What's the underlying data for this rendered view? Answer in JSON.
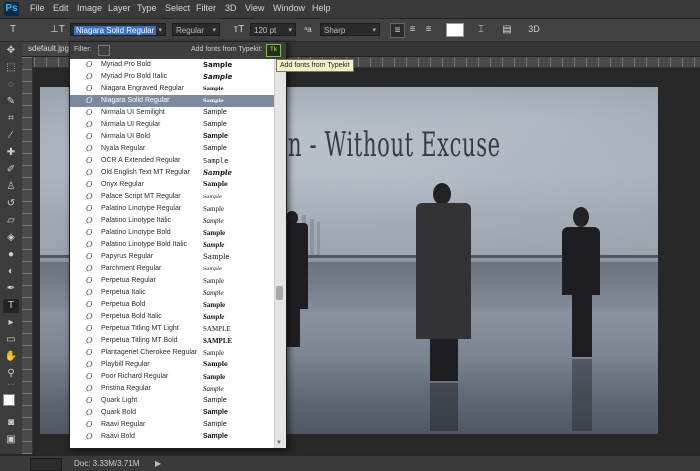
{
  "app": {
    "logo": "Ps"
  },
  "menu": [
    "File",
    "Edit",
    "Image",
    "Layer",
    "Type",
    "Select",
    "Filter",
    "3D",
    "View",
    "Window",
    "Help"
  ],
  "options_bar": {
    "font_family": "Niagara Solid Regular",
    "font_style": "Regular",
    "font_size": "120 pt",
    "aa_label": "ᵃa",
    "antialias": "Sharp",
    "color_swatch": "#ffffff",
    "threed_label": "3D"
  },
  "document": {
    "tab_label": "sdefault.jpg",
    "doc_size": "Doc: 3.33M/3.71M",
    "canvas_title": "n - Without Excuse"
  },
  "font_panel": {
    "filter_label": "Filter:",
    "typekit_label": "Add fonts from Typekit:",
    "typekit_button": "Tk",
    "tooltip": "Add fonts from Typekit",
    "fonts": [
      {
        "name": "Myriad Pro Bold",
        "sample": "Sample"
      },
      {
        "name": "Myriad Pro Bold Italic",
        "sample": "Sample"
      },
      {
        "name": "Niagara Engraved Regular",
        "sample": "Sample"
      },
      {
        "name": "Niagara Solid Regular",
        "sample": "Sample",
        "selected": true
      },
      {
        "name": "Nirmala UI Semilight",
        "sample": "Sample"
      },
      {
        "name": "Nirmala UI Regular",
        "sample": "Sample"
      },
      {
        "name": "Nirmala UI Bold",
        "sample": "Sample"
      },
      {
        "name": "Nyala Regular",
        "sample": "Sample"
      },
      {
        "name": "OCR A Extended Regular",
        "sample": "Sample"
      },
      {
        "name": "Old English Text MT Regular",
        "sample": "Sample"
      },
      {
        "name": "Onyx Regular",
        "sample": "Sample"
      },
      {
        "name": "Palace Script MT Regular",
        "sample": "Sample"
      },
      {
        "name": "Palatino Linotype Regular",
        "sample": "Sample"
      },
      {
        "name": "Palatino Linotype Italic",
        "sample": "Sample"
      },
      {
        "name": "Palatino Linotype Bold",
        "sample": "Sample"
      },
      {
        "name": "Palatino Linotype Bold Italic",
        "sample": "Sample"
      },
      {
        "name": "Papyrus Regular",
        "sample": "Sample"
      },
      {
        "name": "Parchment Regular",
        "sample": "Sample"
      },
      {
        "name": "Perpetua Regular",
        "sample": "Sample"
      },
      {
        "name": "Perpetua Italic",
        "sample": "Sample"
      },
      {
        "name": "Perpetua Bold",
        "sample": "Sample"
      },
      {
        "name": "Perpetua Bold Italic",
        "sample": "Sample"
      },
      {
        "name": "Perpetua Titling MT Light",
        "sample": "SAMPLE"
      },
      {
        "name": "Perpetua Titling MT Bold",
        "sample": "SAMPLE"
      },
      {
        "name": "Plantagenet Cherokee Regular",
        "sample": "Sample"
      },
      {
        "name": "Playbill Regular",
        "sample": "Sample"
      },
      {
        "name": "Poor Richard Regular",
        "sample": "Sample"
      },
      {
        "name": "Pristina Regular",
        "sample": "Sample"
      },
      {
        "name": "Quark Light",
        "sample": "Sample"
      },
      {
        "name": "Quark Bold",
        "sample": "Sample"
      },
      {
        "name": "Raavi Regular",
        "sample": "Sample"
      },
      {
        "name": "Raavi Bold",
        "sample": "Sample"
      }
    ]
  }
}
